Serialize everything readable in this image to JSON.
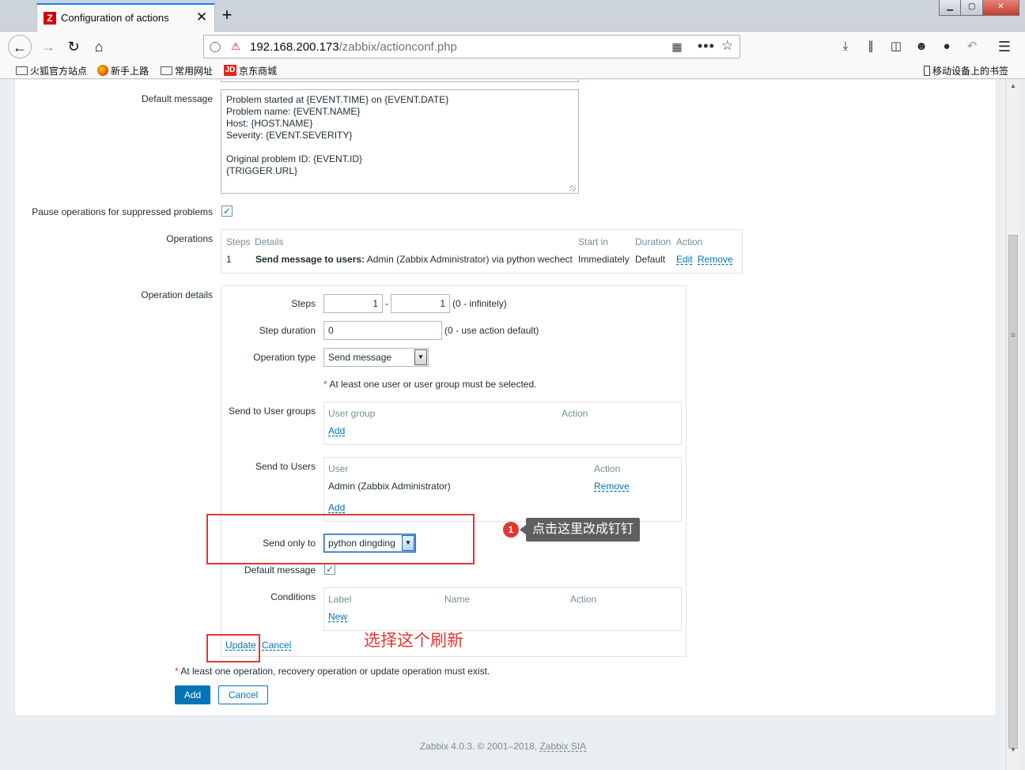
{
  "browser": {
    "tab_title": "Configuration of actions",
    "tab_favicon": "Z",
    "tab_close": "✕",
    "new_tab": "+",
    "url_host": "192.168.200.173",
    "url_path": "/zabbix/actionconf.php",
    "url_more": "•••",
    "window_min": "▁",
    "window_max": "▢",
    "window_close": "✕",
    "bookmarks": [
      "火狐官方站点",
      "新手上路",
      "常用网址",
      "京东商城"
    ],
    "bookmark_jd_badge": "JD",
    "mobile_bookmarks": "移动设备上的书签"
  },
  "form": {
    "default_message_label": "Default message",
    "default_message_text": "Problem started at {EVENT.TIME} on {EVENT.DATE}\nProblem name: {EVENT.NAME}\nHost: {HOST.NAME}\nSeverity: {EVENT.SEVERITY}\n\nOriginal problem ID: {EVENT.ID}\n{TRIGGER.URL}",
    "pause_label": "Pause operations for suppressed problems",
    "pause_checked": "✓",
    "operations_label": "Operations",
    "operations_table": {
      "headers": {
        "steps": "Steps",
        "details": "Details",
        "start_in": "Start in",
        "duration": "Duration",
        "action": "Action"
      },
      "row": {
        "step": "1",
        "details_bold": "Send message to users:",
        "details_rest": " Admin (Zabbix Administrator) via python wechect",
        "start_in": "Immediately",
        "duration": "Default",
        "edit": "Edit",
        "remove": "Remove"
      }
    },
    "operation_details_label": "Operation details",
    "details": {
      "steps_label": "Steps",
      "steps_from": "1",
      "steps_dash": "-",
      "steps_to": "1",
      "steps_hint": "(0 - infinitely)",
      "step_duration_label": "Step duration",
      "step_duration_value": "0",
      "step_duration_hint": "(0 - use action default)",
      "operation_type_label": "Operation type",
      "operation_type_value": "Send message",
      "required_star": "*",
      "required_note": "At least one user or user group must be selected.",
      "user_groups_label": "Send to User groups",
      "user_groups_header_group": "User group",
      "user_groups_header_action": "Action",
      "user_groups_add": "Add",
      "users_label": "Send to Users",
      "users_header_user": "User",
      "users_header_action": "Action",
      "users_row_user": "Admin (Zabbix Administrator)",
      "users_row_remove": "Remove",
      "users_add": "Add",
      "send_only_label": "Send only to",
      "send_only_value": "python dingding",
      "default_message_label": "Default message",
      "default_message_checked": "✓",
      "conditions_label": "Conditions",
      "conditions_header_label": "Label",
      "conditions_header_name": "Name",
      "conditions_header_action": "Action",
      "conditions_new": "New",
      "update_link": "Update",
      "cancel_link": "Cancel"
    },
    "bottom_star": "*",
    "bottom_note": "At least one operation, recovery operation or update operation must exist.",
    "add_button": "Add",
    "cancel_button": "Cancel"
  },
  "annotations": {
    "badge_number": "1",
    "callout_text": "点击这里改成钉钉",
    "update_hint": "选择这个刷新"
  },
  "footer": {
    "text": "Zabbix 4.0.3. © 2001–2018, ",
    "link": "Zabbix SIA"
  },
  "colors": {
    "accent": "#0275b8",
    "annotation_red": "#e33734",
    "callout_bg": "#5f5f5f"
  }
}
